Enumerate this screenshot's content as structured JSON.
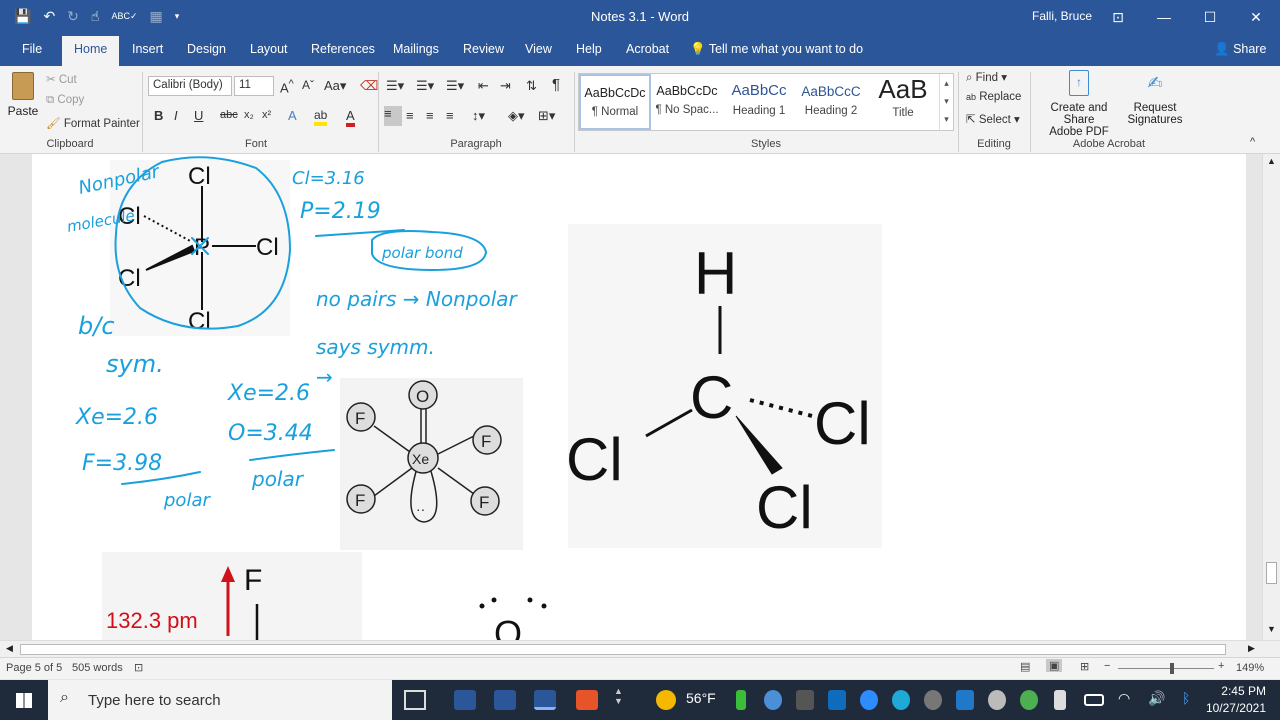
{
  "titlebar": {
    "doc_title": "Notes 3.1  -  Word",
    "user": "Falli, Bruce",
    "icons": [
      "save-icon",
      "undo-icon",
      "redo-icon",
      "touch-mode-icon",
      "spelling-icon",
      "format-icon",
      "customize-qat-icon"
    ]
  },
  "tabs": [
    "File",
    "Home",
    "Insert",
    "Design",
    "Layout",
    "References",
    "Mailings",
    "Review",
    "View",
    "Help",
    "Acrobat"
  ],
  "tell_me": "Tell me what you want to do",
  "share": "Share",
  "ribbon": {
    "clipboard": {
      "paste": "Paste",
      "cut": "Cut",
      "copy": "Copy",
      "format_painter": "Format Painter",
      "label": "Clipboard"
    },
    "font": {
      "name": "Calibri (Body)",
      "size": "11",
      "label": "Font"
    },
    "paragraph": {
      "label": "Paragraph"
    },
    "styles": {
      "label": "Styles",
      "items": [
        {
          "preview": "AaBbCcDc",
          "name": "¶ Normal"
        },
        {
          "preview": "AaBbCcDc",
          "name": "¶ No Spac..."
        },
        {
          "preview": "AaBbCc",
          "name": "Heading 1"
        },
        {
          "preview": "AaBbCcC",
          "name": "Heading 2"
        },
        {
          "preview": "AaB",
          "name": "Title"
        }
      ]
    },
    "editing": {
      "find": "Find",
      "replace": "Replace",
      "select": "Select",
      "label": "Editing"
    },
    "acrobat": {
      "create_line1": "Create and Share",
      "create_line2": "Adobe PDF",
      "request_line1": "Request",
      "request_line2": "Signatures",
      "label": "Adobe Acrobat"
    }
  },
  "document": {
    "pcl5": {
      "atoms": [
        "Cl",
        "Cl",
        "P",
        "Cl",
        "Cl",
        "Cl"
      ]
    },
    "xeof4": {
      "atoms": [
        "O",
        "F",
        "F",
        "Xe",
        "F",
        "F"
      ],
      "lone_pair": "··"
    },
    "chcl3": {
      "atoms": [
        "H",
        "C",
        "Cl",
        "Cl",
        "Cl"
      ]
    },
    "bond_length": {
      "value": "132.3 pm",
      "atom": "F"
    },
    "partial_o": "O",
    "notes": {
      "nonpolar": "Nonpolar",
      "molecule": "molecule",
      "cl_en": "Cl=3.16",
      "p_en": "P=2.19",
      "polar_bond": "polar bond",
      "lone_pairs": "no pairs → Nonpolar",
      "says_symm": "says symm.",
      "bc": "b/c",
      "sym": "sym.",
      "xe_en": "Xe=2.6",
      "f_en": "F=3.98",
      "polar_left": "polar",
      "xe_en2": "Xe=2.6",
      "o_en": "O=3.44",
      "polar_mid": "polar",
      "arrow": "→"
    }
  },
  "status": {
    "page": "Page 5 of 5",
    "words": "505 words",
    "zoom": "149%"
  },
  "taskbar": {
    "search_placeholder": "Type here to search",
    "weather": "56°F",
    "time": "2:45 PM",
    "date": "10/27/2021"
  }
}
